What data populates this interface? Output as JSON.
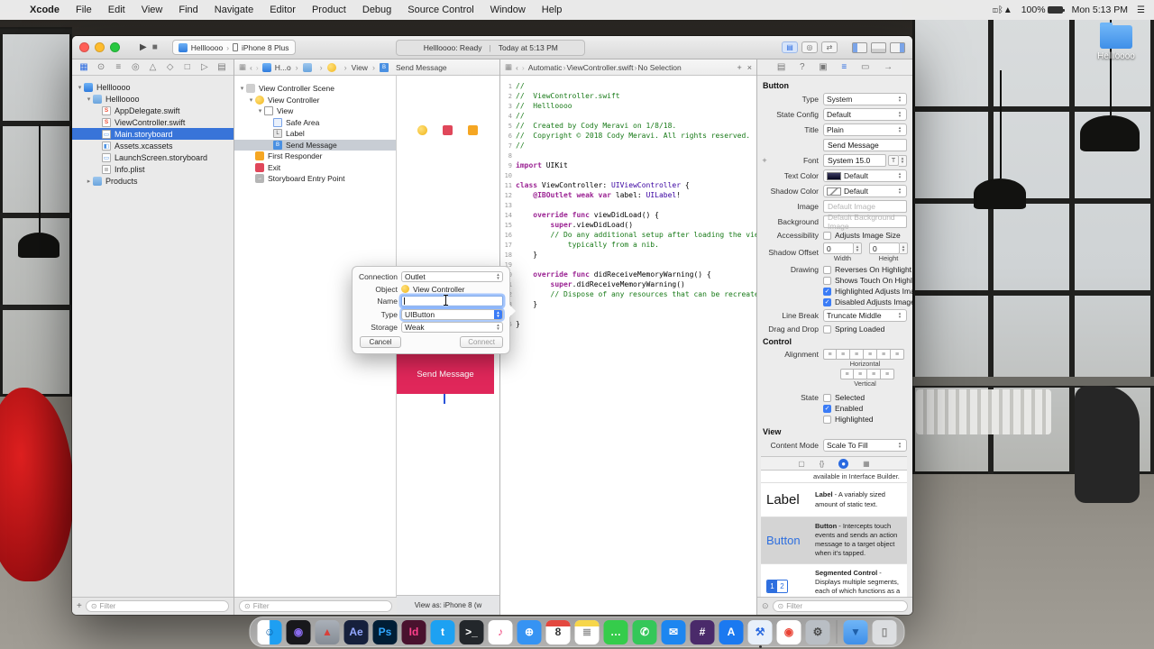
{
  "menu_bar": {
    "apple": "",
    "items": [
      "Xcode",
      "File",
      "Edit",
      "View",
      "Find",
      "Navigate",
      "Editor",
      "Product",
      "Debug",
      "Source Control",
      "Window",
      "Help"
    ],
    "status": {
      "icons": [
        {
          "name": "display-icon",
          "glyph": "◫"
        },
        {
          "name": "bluetooth-icon",
          "glyph": "ᛒ"
        },
        {
          "name": "wifi-icon",
          "glyph": "▲"
        }
      ],
      "battery": "100%",
      "clock": "Mon 5:13 PM",
      "notification": "☰"
    }
  },
  "desktop": {
    "folder_label": "Hellloooo"
  },
  "window": {
    "toolbar": {
      "scheme": "Hellloooo",
      "device": "iPhone 8 Plus",
      "status_main": "Hellloooo: Ready",
      "status_sep": "|",
      "status_time": "Today at 5:13 PM"
    },
    "navigator": {
      "tabs": [
        {
          "name": "navigator-tab-project",
          "glyph": "▦",
          "on": true
        },
        {
          "name": "navigator-tab-source-control",
          "glyph": "⊙"
        },
        {
          "name": "navigator-tab-symbols",
          "glyph": "≡"
        },
        {
          "name": "navigator-tab-find",
          "glyph": "◎"
        },
        {
          "name": "navigator-tab-issues",
          "glyph": "△"
        },
        {
          "name": "navigator-tab-tests",
          "glyph": "◇"
        },
        {
          "name": "navigator-tab-debug",
          "glyph": "□"
        },
        {
          "name": "navigator-tab-breakpoints",
          "glyph": "▷"
        },
        {
          "name": "navigator-tab-reports",
          "glyph": "▤"
        }
      ],
      "files": [
        {
          "label": "Hellloooo",
          "level": 0,
          "icon": "proj",
          "disc": "▾"
        },
        {
          "label": "Hellloooo",
          "level": 1,
          "icon": "folder",
          "disc": "▾"
        },
        {
          "label": "AppDelegate.swift",
          "level": 2,
          "icon": "swift"
        },
        {
          "label": "ViewController.swift",
          "level": 2,
          "icon": "swift"
        },
        {
          "label": "Main.storyboard",
          "level": 2,
          "icon": "sb",
          "selected": true
        },
        {
          "label": "Assets.xcassets",
          "level": 2,
          "icon": "assets"
        },
        {
          "label": "LaunchScreen.storyboard",
          "level": 2,
          "icon": "sb"
        },
        {
          "label": "Info.plist",
          "level": 2,
          "icon": "plist"
        },
        {
          "label": "Products",
          "level": 1,
          "icon": "folder",
          "disc": "▸"
        }
      ],
      "filter_placeholder": "Filter"
    },
    "outline": {
      "crumb_app": "H...o",
      "crumb_view": "View",
      "crumb_item": "Send Message",
      "items": [
        {
          "label": "View Controller Scene",
          "level": 0,
          "icon": "scene",
          "disc": "▾"
        },
        {
          "label": "View Controller",
          "level": 1,
          "icon": "vc",
          "disc": "▾"
        },
        {
          "label": "View",
          "level": 2,
          "icon": "view",
          "disc": "▾"
        },
        {
          "label": "Safe Area",
          "level": 3,
          "icon": "safe"
        },
        {
          "label": "Label",
          "level": 3,
          "icon": "L",
          "glyph": "L"
        },
        {
          "label": "Send Message",
          "level": 3,
          "icon": "B",
          "glyph": "B",
          "selected": true
        },
        {
          "label": "First Responder",
          "level": 1,
          "icon": "resp"
        },
        {
          "label": "Exit",
          "level": 1,
          "icon": "exit"
        },
        {
          "label": "Storyboard Entry Point",
          "level": 1,
          "icon": "entry",
          "glyph": "→"
        }
      ],
      "filter_placeholder": "Filter"
    },
    "canvas": {
      "button_title": "Send Message",
      "view_as": "View as: iPhone 8 (w"
    },
    "editor": {
      "crumbs": [
        "Automatic",
        "ViewController.swift",
        "No Selection"
      ],
      "add_glyph": "+",
      "close_glyph": "×",
      "lines": [
        {
          "n": "1",
          "s": [
            [
              "c",
              "//"
            ]
          ]
        },
        {
          "n": "2",
          "s": [
            [
              "c",
              "//  ViewController.swift"
            ]
          ]
        },
        {
          "n": "3",
          "s": [
            [
              "c",
              "//  Hellloooo"
            ]
          ]
        },
        {
          "n": "4",
          "s": [
            [
              "c",
              "//"
            ]
          ]
        },
        {
          "n": "5",
          "s": [
            [
              "c",
              "//  Created by Cody Meravi on 1/8/18."
            ]
          ]
        },
        {
          "n": "6",
          "s": [
            [
              "c",
              "//  Copyright © 2018 Cody Meravi. All rights reserved."
            ]
          ]
        },
        {
          "n": "7",
          "s": [
            [
              "c",
              "//"
            ]
          ]
        },
        {
          "n": "8",
          "s": []
        },
        {
          "n": "9",
          "s": [
            [
              "k",
              "import"
            ],
            [
              "p",
              " UIKit"
            ]
          ]
        },
        {
          "n": "10",
          "s": []
        },
        {
          "n": "11",
          "s": [
            [
              "k",
              "class"
            ],
            [
              "p",
              " ViewController: "
            ],
            [
              "t",
              "UIViewController"
            ],
            [
              "p",
              " {"
            ]
          ]
        },
        {
          "n": "12",
          "s": [
            [
              "p",
              "    "
            ],
            [
              "k",
              "@IBOutlet"
            ],
            [
              "p",
              " "
            ],
            [
              "k",
              "weak"
            ],
            [
              "p",
              " "
            ],
            [
              "k",
              "var"
            ],
            [
              "p",
              " label: "
            ],
            [
              "t",
              "UILabel"
            ],
            [
              "p",
              "!"
            ]
          ]
        },
        {
          "n": "13",
          "s": []
        },
        {
          "n": "14",
          "s": [
            [
              "p",
              "    "
            ],
            [
              "k",
              "override"
            ],
            [
              "p",
              " "
            ],
            [
              "k",
              "func"
            ],
            [
              "p",
              " viewDidLoad() {"
            ]
          ]
        },
        {
          "n": "15",
          "s": [
            [
              "p",
              "        "
            ],
            [
              "k",
              "super"
            ],
            [
              "p",
              ".viewDidLoad()"
            ]
          ]
        },
        {
          "n": "16",
          "s": [
            [
              "p",
              "        "
            ],
            [
              "c",
              "// Do any additional setup after loading the view,"
            ]
          ]
        },
        {
          "n": "17",
          "s": [
            [
              "p",
              "            "
            ],
            [
              "c",
              "typically from a nib."
            ]
          ]
        },
        {
          "n": "18",
          "s": [
            [
              "p",
              "    }"
            ]
          ]
        },
        {
          "n": "19",
          "s": []
        },
        {
          "n": "20",
          "s": [
            [
              "p",
              "    "
            ],
            [
              "k",
              "override"
            ],
            [
              "p",
              " "
            ],
            [
              "k",
              "func"
            ],
            [
              "p",
              " didReceiveMemoryWarning() {"
            ]
          ]
        },
        {
          "n": "21",
          "s": [
            [
              "p",
              "        "
            ],
            [
              "k",
              "super"
            ],
            [
              "p",
              ".didReceiveMemoryWarning()"
            ]
          ]
        },
        {
          "n": "22",
          "s": [
            [
              "p",
              "        "
            ],
            [
              "c",
              "// Dispose of any resources that can be recreated."
            ]
          ]
        },
        {
          "n": "23",
          "s": [
            [
              "p",
              "    }"
            ]
          ]
        },
        {
          "n": "24",
          "s": []
        },
        {
          "n": "25",
          "s": [
            [
              "p",
              "}"
            ]
          ]
        }
      ]
    },
    "inspector": {
      "tabs": [
        {
          "name": "file-inspector-icon",
          "glyph": "▤"
        },
        {
          "name": "quick-help-inspector-icon",
          "glyph": "?"
        },
        {
          "name": "identity-inspector-icon",
          "glyph": "▣"
        },
        {
          "name": "attributes-inspector-icon",
          "glyph": "≡",
          "on": true
        },
        {
          "name": "size-inspector-icon",
          "glyph": "▭"
        },
        {
          "name": "connections-inspector-icon",
          "glyph": "→"
        }
      ],
      "button_section": "Button",
      "type_label": "Type",
      "type_value": "System",
      "state_config_label": "State Config",
      "state_config_value": "Default",
      "title_label": "Title",
      "title_value": "Plain",
      "title_text": "Send Message",
      "font_label": "Font",
      "font_value": "System 15.0",
      "text_color_label": "Text Color",
      "text_color_value": "Default",
      "shadow_color_label": "Shadow Color",
      "shadow_color_value": "Default",
      "image_label": "Image",
      "image_placeholder": "Default Image",
      "background_label": "Background",
      "background_placeholder": "Default Background Image",
      "accessibility_label": "Accessibility",
      "accessibility_option": "Adjusts Image Size",
      "shadow_offset_label": "Shadow Offset",
      "shadow_w": "0",
      "shadow_h": "0",
      "width_label": "Width",
      "height_label": "Height",
      "drawing_label": "Drawing",
      "drawing_options": [
        {
          "text": "Reverses On Highlight",
          "checked": false
        },
        {
          "text": "Shows Touch On Highlight",
          "checked": false
        },
        {
          "text": "Highlighted Adjusts Image",
          "checked": true
        },
        {
          "text": "Disabled Adjusts Image",
          "checked": true
        }
      ],
      "line_break_label": "Line Break",
      "line_break_value": "Truncate Middle",
      "drag_label": "Drag and Drop",
      "drag_option": "Spring Loaded",
      "control_section": "Control",
      "alignment_label": "Alignment",
      "horizontal_label": "Horizontal",
      "vertical_label": "Vertical",
      "state_label": "State",
      "state_options": [
        {
          "text": "Selected",
          "checked": false
        },
        {
          "text": "Enabled",
          "checked": true
        },
        {
          "text": "Highlighted",
          "checked": false
        }
      ],
      "view_section": "View",
      "content_mode_label": "Content Mode",
      "content_mode_value": "Scale To Fill"
    },
    "library": {
      "cutoff": "available in Interface Builder.",
      "items": [
        {
          "kind": "label",
          "title": "Label",
          "desc": "A variably sized amount of static text.",
          "selected": false
        },
        {
          "kind": "button",
          "title": "Button",
          "desc": "Intercepts touch events and sends an action message to a target object when it's tapped.",
          "selected": true
        },
        {
          "kind": "segmented",
          "title": "Segmented Control",
          "desc": "Displays multiple segments, each of which functions as a discrete button.",
          "selected": false
        }
      ],
      "filter_placeholder": "Filter"
    },
    "popover": {
      "connection_label": "Connection",
      "connection_value": "Outlet",
      "object_label": "Object",
      "object_value": "View Controller",
      "name_label": "Name",
      "name_value": "",
      "type_label": "Type",
      "type_value": "UIButton",
      "storage_label": "Storage",
      "storage_value": "Weak",
      "cancel": "Cancel",
      "connect": "Connect"
    }
  },
  "dock": {
    "apps": [
      {
        "name": "finder",
        "bg": "linear-gradient(90deg,#ffffff 48%,#1e9ff2 52%)",
        "glyph": "☺",
        "fg": "#0b5aa0"
      },
      {
        "name": "siri",
        "bg": "#18181c",
        "glyph": "◉",
        "fg": "#8b6cf0"
      },
      {
        "name": "launchpad",
        "bg": "linear-gradient(#aab0b8,#858c95)",
        "glyph": "▲",
        "fg": "#d8403a"
      },
      {
        "name": "after-effects",
        "bg": "#16203c",
        "glyph": "Ae",
        "fg": "#94a8ff"
      },
      {
        "name": "photoshop",
        "bg": "#001e36",
        "glyph": "Ps",
        "fg": "#31a8ff"
      },
      {
        "name": "indesign",
        "bg": "#49122e",
        "glyph": "Id",
        "fg": "#ff408c"
      },
      {
        "name": "twitter",
        "bg": "#1da1f2",
        "glyph": "t",
        "fg": "#ffffff"
      },
      {
        "name": "terminal",
        "bg": "#23272b",
        "glyph": ">_",
        "fg": "#ffffff"
      },
      {
        "name": "itunes",
        "bg": "#ffffff",
        "glyph": "♪",
        "fg": "#f0447c"
      },
      {
        "name": "safari",
        "bg": "#3693f3",
        "glyph": "⊕",
        "fg": "#ffffff"
      },
      {
        "name": "calendar",
        "bg": "#ffffff",
        "glyph": "8",
        "fg": "#333333",
        "style": "cal"
      },
      {
        "name": "notes",
        "bg": "#ffffff",
        "glyph": "≣",
        "fg": "#999999",
        "style": "note"
      },
      {
        "name": "messages",
        "bg": "#35cc4b",
        "glyph": "…",
        "fg": "#ffffff"
      },
      {
        "name": "facetime",
        "bg": "#34c759",
        "glyph": "✆",
        "fg": "#ffffff"
      },
      {
        "name": "mail",
        "bg": "#1d86f0",
        "glyph": "✉",
        "fg": "#ffffff"
      },
      {
        "name": "slack",
        "bg": "#4a2a6a",
        "glyph": "#",
        "fg": "#ffffff"
      },
      {
        "name": "app-store",
        "bg": "#1b79f0",
        "glyph": "A",
        "fg": "#ffffff"
      },
      {
        "name": "xcode",
        "bg": "#e8f0fa",
        "glyph": "⚒",
        "fg": "#2a6ae0",
        "running": true
      },
      {
        "name": "chrome",
        "bg": "#ffffff",
        "glyph": "◉",
        "fg": "#ea4335"
      },
      {
        "name": "system-preferences",
        "bg": "#b9bec4",
        "glyph": "⚙",
        "fg": "#4a4a4a"
      },
      {
        "name": "downloads-folder",
        "bg": "linear-gradient(#6fb5f7,#3f8fe8)",
        "glyph": "▼",
        "fg": "#1f5fa8",
        "sep_before": true
      },
      {
        "name": "trash",
        "bg": "rgba(228,230,234,0.85)",
        "glyph": "▯",
        "fg": "#8a8a8a"
      }
    ]
  }
}
